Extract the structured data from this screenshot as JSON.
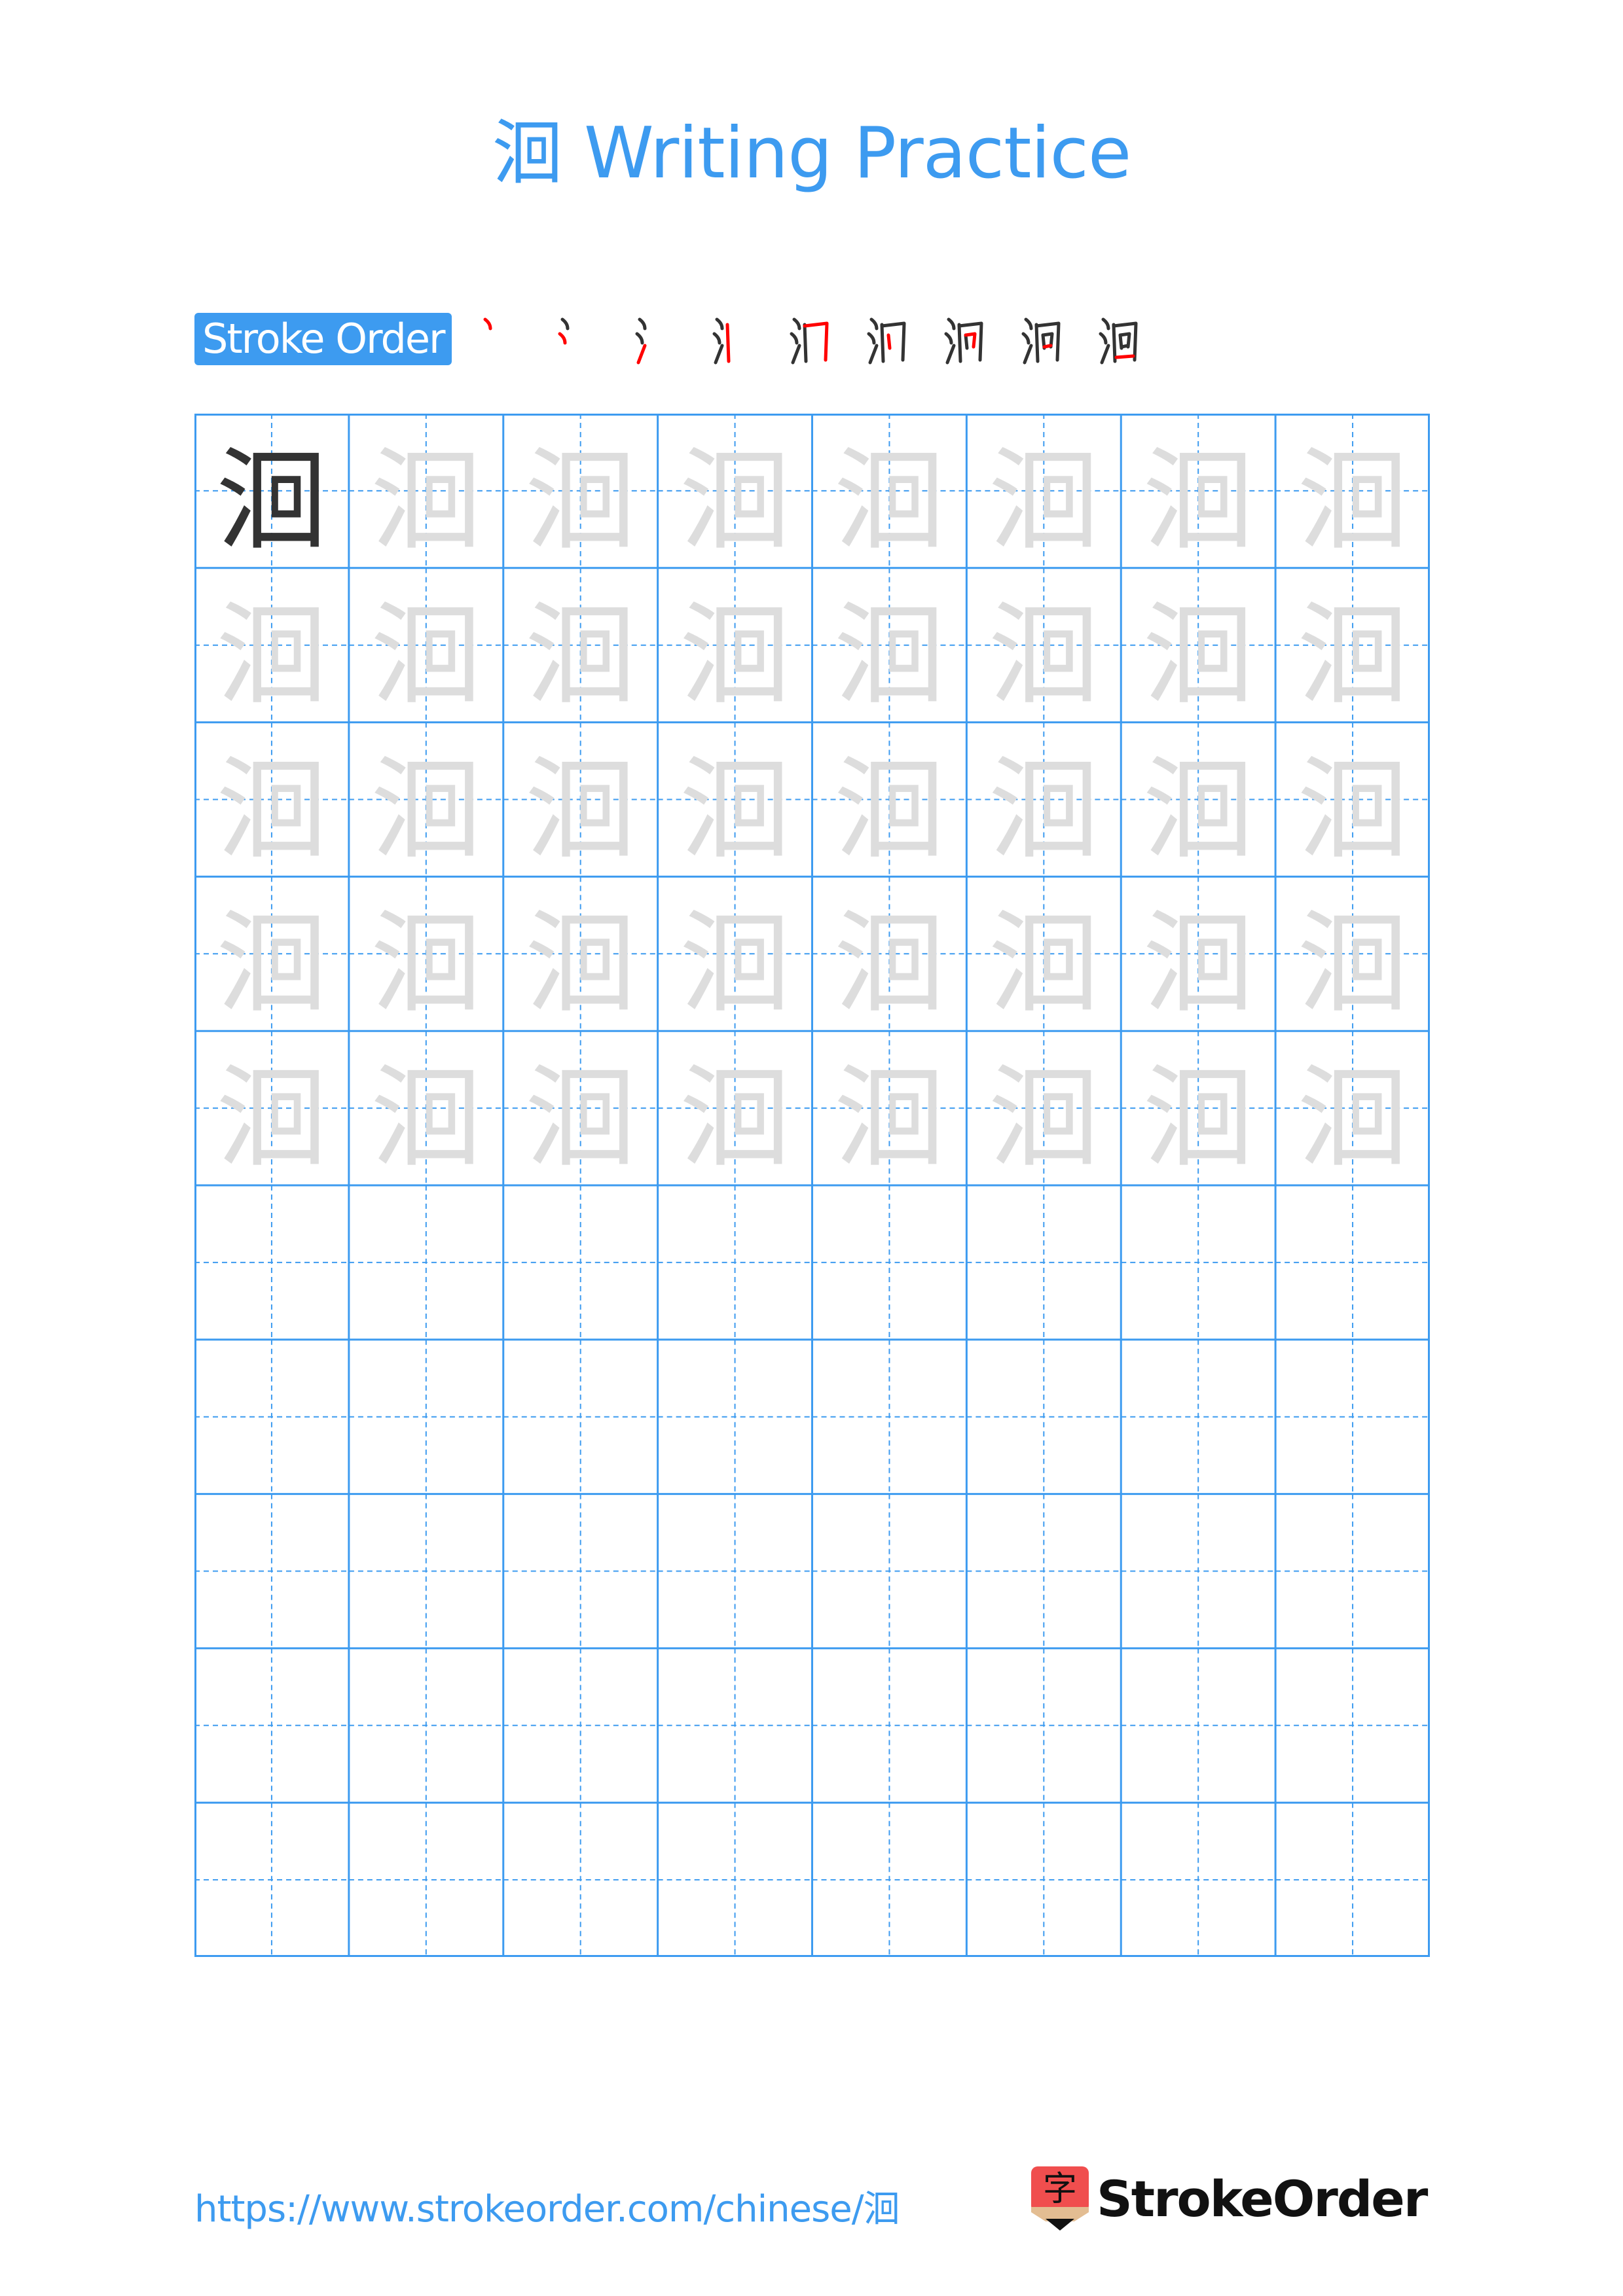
{
  "header": {
    "title": "洄 Writing Practice"
  },
  "stroke_order": {
    "label": "Stroke Order",
    "character": "洄",
    "step_count": 9,
    "highlight_color": "#ff0000",
    "done_color": "#333333"
  },
  "grid": {
    "columns": 8,
    "rows": 10,
    "character": "洄",
    "filled_rows": 5,
    "model_color": "#333333",
    "trace_color": "#dddddd",
    "line_color": "#3d9bf0"
  },
  "footer": {
    "url": "https://www.strokeorder.com/chinese/洄",
    "brand_name": "StrokeOrder",
    "brand_icon_glyph": "字",
    "brand_icon_color": "#f04e4e"
  }
}
